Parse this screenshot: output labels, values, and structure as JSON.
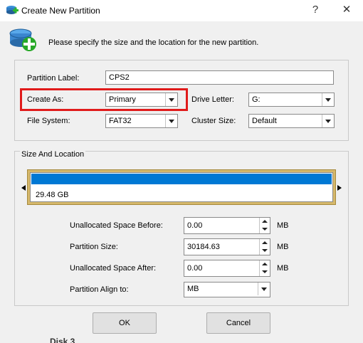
{
  "window": {
    "title": "Create New Partition",
    "help": "?",
    "close": "✕"
  },
  "header": {
    "instruction": "Please specify the size and the location for the new partition."
  },
  "form": {
    "partition_label": {
      "label": "Partition Label:",
      "value": "CPS2"
    },
    "create_as": {
      "label": "Create As:",
      "value": "Primary"
    },
    "drive_letter": {
      "label": "Drive Letter:",
      "value": "G:"
    },
    "file_system": {
      "label": "File System:",
      "value": "FAT32"
    },
    "cluster_size": {
      "label": "Cluster Size:",
      "value": "Default"
    }
  },
  "size_location": {
    "group_title": "Size And Location",
    "bar_fill_fraction": 1.0,
    "bar_size_label": "29.48 GB",
    "fields": [
      {
        "label": "Unallocated Space Before:",
        "value": "0.00",
        "unit": "MB"
      },
      {
        "label": "Partition Size:",
        "value": "30184.63",
        "unit": "MB"
      },
      {
        "label": "Unallocated Space After:",
        "value": "0.00",
        "unit": "MB"
      }
    ],
    "align": {
      "label": "Partition Align to:",
      "value": "MB"
    }
  },
  "buttons": {
    "ok": "OK",
    "cancel": "Cancel"
  },
  "background_partial_text": "Disk 3",
  "colors": {
    "highlight": "#e01b1b",
    "bar_blue": "#0078d4",
    "bar_frame": "#d6b86a"
  }
}
